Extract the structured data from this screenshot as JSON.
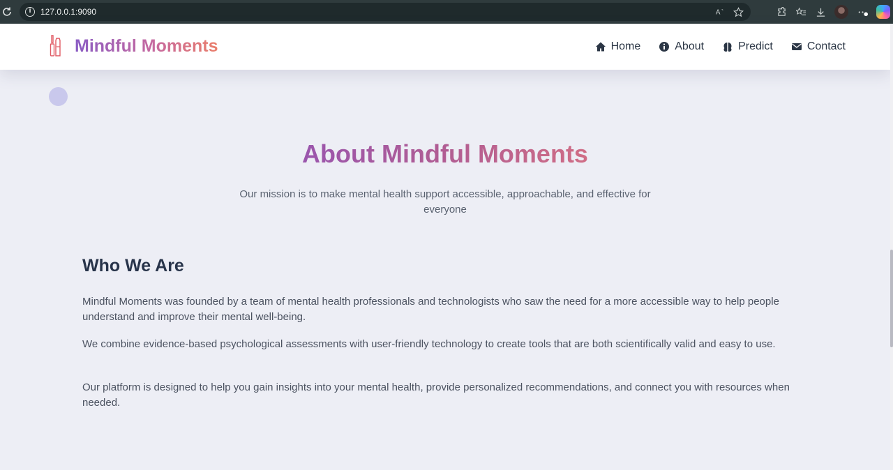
{
  "browser": {
    "url": "127.0.0.1:9090"
  },
  "header": {
    "brand_name": "Mindful Moments",
    "brand_icon": "makeup-brush-icon",
    "nav": [
      {
        "label": "Home",
        "icon": "home-icon"
      },
      {
        "label": "About",
        "icon": "info-icon"
      },
      {
        "label": "Predict",
        "icon": "brain-icon"
      },
      {
        "label": "Contact",
        "icon": "envelope-icon"
      }
    ]
  },
  "hero": {
    "title": "About Mindful Moments",
    "subtitle": "Our mission is to make mental health support accessible, approachable, and effective for everyone"
  },
  "who_we_are": {
    "title": "Who We Are",
    "paragraphs": [
      "Mindful Moments was founded by a team of mental health professionals and technologists who saw the need for a more accessible way to help people understand and improve their mental well-being.",
      "We combine evidence-based psychological assessments with user-friendly technology to create tools that are both scientifically valid and easy to use.",
      "Our platform is designed to help you gain insights into your mental health, provide personalized recommendations, and connect you with resources when needed."
    ]
  },
  "colors": {
    "brand_gradient_start": "#8a5cc4",
    "brand_gradient_end": "#ea7e6a",
    "heading": "#28344a",
    "body_text": "#4b5260",
    "page_background": "#edeef5"
  }
}
